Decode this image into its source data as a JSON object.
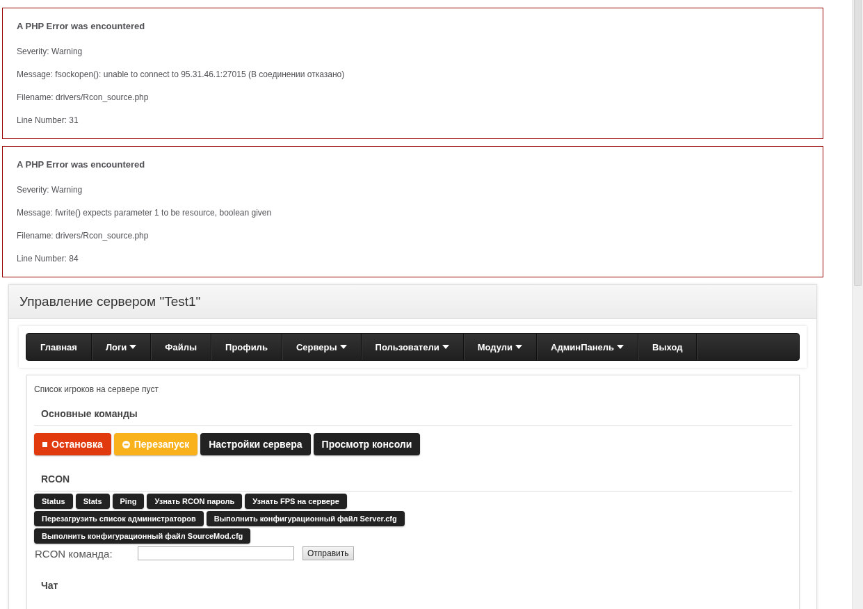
{
  "errors": [
    {
      "title": "A PHP Error was encountered",
      "lines": [
        "Severity: Warning",
        "Message: fsockopen(): unable to connect to 95.31.46.1:27015 (В соединении отказано)",
        "Filename: drivers/Rcon_source.php",
        "Line Number: 31"
      ]
    },
    {
      "title": "A PHP Error was encountered",
      "lines": [
        "Severity: Warning",
        "Message: fwrite() expects parameter 1 to be resource, boolean given",
        "Filename: drivers/Rcon_source.php",
        "Line Number: 84"
      ]
    }
  ],
  "panel": {
    "title": "Управление сервером \"Test1\"",
    "nav": [
      {
        "label": "Главная",
        "dropdown": false
      },
      {
        "label": "Логи",
        "dropdown": true
      },
      {
        "label": "Файлы",
        "dropdown": false
      },
      {
        "label": "Профиль",
        "dropdown": false
      },
      {
        "label": "Серверы",
        "dropdown": true
      },
      {
        "label": "Пользователи",
        "dropdown": true
      },
      {
        "label": "Модули",
        "dropdown": true
      },
      {
        "label": "АдминПанель",
        "dropdown": true
      },
      {
        "label": "Выход",
        "dropdown": false
      }
    ],
    "players_note": "Список игроков на сервере пуст",
    "main_heading": "Основные команды",
    "main_buttons": [
      {
        "label": "Остановка",
        "kind": "stop",
        "color": "#e03a0e"
      },
      {
        "label": "Перезапуск",
        "kind": "restart",
        "color": "#f9b21c"
      },
      {
        "label": "Настройки сервера",
        "kind": "plain",
        "color": "#222222"
      },
      {
        "label": "Просмотр консоли",
        "kind": "plain",
        "color": "#222222"
      }
    ],
    "rcon_heading": "RCON",
    "rcon_buttons": [
      [
        "Status",
        "Stats",
        "Ping",
        "Узнать RCON пароль",
        "Узнать FPS на сервере"
      ],
      [
        "Перезагрузить список администраторов",
        "Выполнить конфигурационный файл Server.cfg"
      ],
      [
        "Выполнить конфигурационный файл SourceMod.cfg"
      ]
    ],
    "rcon_label": "RCON команда:",
    "send_button": "Отправить",
    "chat_heading": "Чат"
  }
}
